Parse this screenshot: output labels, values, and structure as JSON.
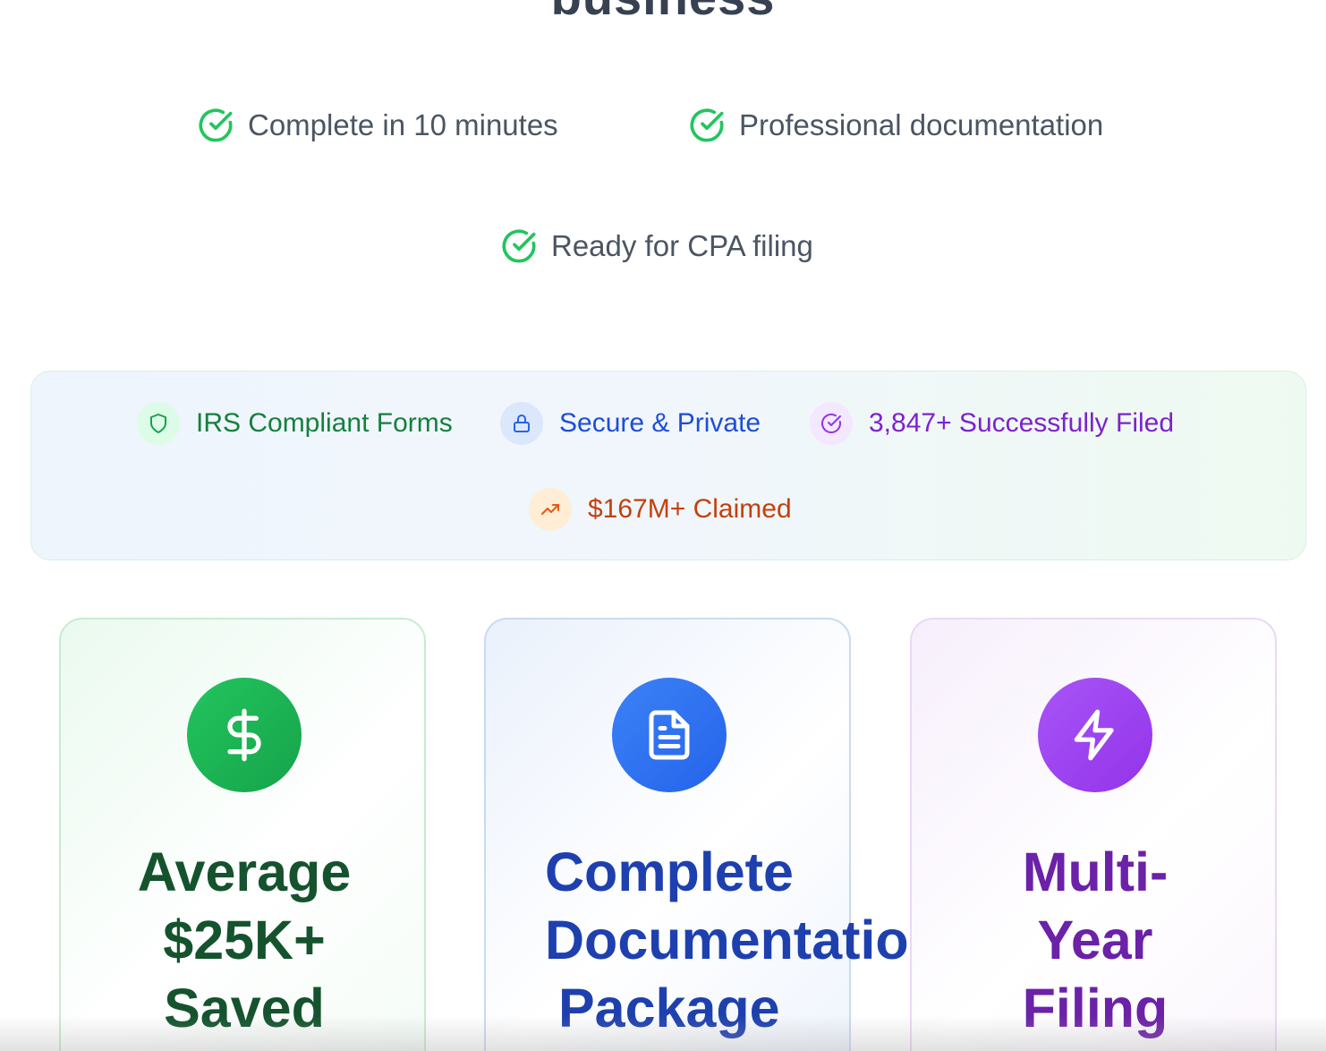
{
  "hero": {
    "heading_partial": "business"
  },
  "benefits": [
    {
      "label": "Complete in 10 minutes",
      "icon": "check-circle-icon"
    },
    {
      "label": "Professional documentation",
      "icon": "check-circle-icon"
    },
    {
      "label": "Ready for CPA filing",
      "icon": "check-circle-icon"
    }
  ],
  "trust_bar": {
    "items": [
      {
        "label": "IRS Compliant Forms",
        "icon": "shield-icon",
        "color": "#15803d"
      },
      {
        "label": "Secure & Private",
        "icon": "lock-icon",
        "color": "#1d4ed8"
      },
      {
        "label": "3,847+ Successfully Filed",
        "icon": "check-circle-icon",
        "color": "#7e22ce"
      },
      {
        "label": "$167M+ Claimed",
        "icon": "trending-up-icon",
        "color": "#c2410c"
      }
    ]
  },
  "cards": [
    {
      "icon": "dollar-icon",
      "title_lines": [
        "Average",
        "$25K+",
        "Saved"
      ],
      "color": "#16a34a"
    },
    {
      "icon": "document-icon",
      "title_lines": [
        "Complete",
        "Documentatio",
        "Package"
      ],
      "color": "#2563eb"
    },
    {
      "icon": "lightning-icon",
      "title_lines": [
        "Multi-",
        "Year",
        "Filing"
      ],
      "color": "#9333ea"
    }
  ]
}
